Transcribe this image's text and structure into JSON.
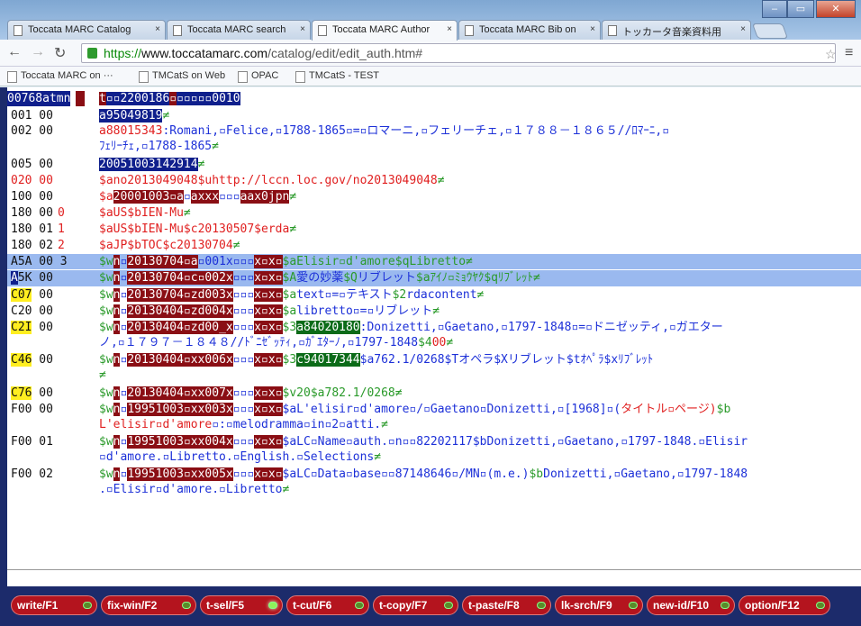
{
  "tabs": [
    {
      "label": "Toccata MARC Catalog"
    },
    {
      "label": "Toccata MARC search"
    },
    {
      "label": "Toccata MARC Author"
    },
    {
      "label": "Toccata MARC Bib on"
    },
    {
      "label": "トッカータ音楽資料用"
    }
  ],
  "address": {
    "https": "https://",
    "host": "www.toccatamarc.com",
    "path": "/catalog/edit/edit_auth.htm#"
  },
  "bookmarks": [
    "Toccata MARC on ···",
    "TMCatS on Web",
    "OPAC",
    "TMCatS - TEST"
  ],
  "leader": {
    "a": "00768atmn",
    "b": "t",
    "c": "▫▫2200186",
    "d": "▫",
    "e": "▫▫▫▫▫0010"
  },
  "rows": [
    {
      "tag": "001 00",
      "ind": "",
      "f": [
        {
          "t": "a95049819",
          "c": "sel"
        },
        {
          "t": "≠",
          "c": "grn"
        }
      ]
    },
    {
      "tag": "002 00",
      "ind": "",
      "f": [
        {
          "t": "a88015343",
          "c": "red"
        },
        {
          "t": ":Romani,▫Felice,▫1788-1865▫=▫ロマーニ,▫フェリーチェ,▫１７８８－１８６５//ﾛﾏｰﾆ,▫",
          "c": "blu"
        },
        {
          "br": true
        },
        {
          "t": "ﾌｪﾘｰﾁｪ,▫1788-1865",
          "c": "blu"
        },
        {
          "t": "≠",
          "c": "grn"
        }
      ]
    },
    {
      "tag": "005 00",
      "ind": "",
      "f": [
        {
          "t": "20051003142914",
          "c": "sel"
        },
        {
          "t": "≠",
          "c": "grn"
        }
      ]
    },
    {
      "tag": "020 00",
      "tagred": true,
      "ind": "",
      "f": [
        {
          "t": "$ano2013049048$uhttp://lccn.loc.gov/no2013049048",
          "c": "red"
        },
        {
          "t": "≠",
          "c": "grn"
        }
      ]
    },
    {
      "tag": "100 00",
      "ind": "",
      "f": [
        {
          "t": "$a",
          "c": "red"
        },
        {
          "t": "20001003",
          "c": "brn"
        },
        {
          "t": "▫a",
          "c": "brn"
        },
        {
          "t": "▫",
          "c": "blu"
        },
        {
          "t": "axxx",
          "c": "brn"
        },
        {
          "t": "▫▫▫",
          "c": "blu"
        },
        {
          "t": "aax0jpn",
          "c": "brn"
        },
        {
          "t": "≠",
          "c": "grn"
        }
      ]
    },
    {
      "tag": "180 00",
      "ind": "0",
      "f": [
        {
          "t": "$aUS$bIEN-Mu",
          "c": "red"
        },
        {
          "t": "≠",
          "c": "grn"
        }
      ]
    },
    {
      "tag": "180 01",
      "ind": "1",
      "f": [
        {
          "t": "$aUS$bIEN-Mu$c20130507$erda",
          "c": "red"
        },
        {
          "t": "≠",
          "c": "grn"
        }
      ]
    },
    {
      "tag": "180 02",
      "ind": "2",
      "f": [
        {
          "t": "$aJP$bTOC$c20130704",
          "c": "red"
        },
        {
          "t": "≠",
          "c": "grn"
        }
      ]
    },
    {
      "tag": "A5A 00 3",
      "hl": true,
      "ind": "",
      "f": [
        {
          "t": "$w",
          "c": "grn"
        },
        {
          "t": "n",
          "c": "brn"
        },
        {
          "t": "▫",
          "c": "blu"
        },
        {
          "t": "20130704",
          "c": "brn"
        },
        {
          "t": "▫a",
          "c": "brn"
        },
        {
          "t": "▫001x",
          "c": "blu"
        },
        {
          "t": "▫▫▫",
          "c": "blu"
        },
        {
          "t": "x▫x▫",
          "c": "brn"
        },
        {
          "t": "$aElisir▫d'amore$qLibretto",
          "c": "grn"
        },
        {
          "t": "≠",
          "c": "grn"
        }
      ]
    },
    {
      "tag": "A5K 00",
      "hl": true,
      "cursor": true,
      "ind": "",
      "f": [
        {
          "t": "$w",
          "c": "grn"
        },
        {
          "t": "n",
          "c": "brn"
        },
        {
          "t": "▫",
          "c": "blu"
        },
        {
          "t": "20130704",
          "c": "brn"
        },
        {
          "t": "▫c▫",
          "c": "brn"
        },
        {
          "t": "002x",
          "c": "brn"
        },
        {
          "t": "▫▫▫",
          "c": "blu"
        },
        {
          "t": "x▫x▫",
          "c": "brn"
        },
        {
          "t": "$A",
          "c": "grn"
        },
        {
          "t": "愛の妙薬",
          "c": "blu"
        },
        {
          "t": "$Q",
          "c": "grn"
        },
        {
          "t": "リブレット",
          "c": "blu"
        },
        {
          "t": "$aｱｲﾉ▫ﾐｮｳﾔｸ$qﾘﾌﾞﾚｯﾄ",
          "c": "grn"
        },
        {
          "t": "≠",
          "c": "grn"
        }
      ]
    },
    {
      "tag": "C07 00",
      "tagyel": true,
      "ind": "",
      "f": [
        {
          "t": "$w",
          "c": "grn"
        },
        {
          "t": "n",
          "c": "brn"
        },
        {
          "t": "▫",
          "c": "blu"
        },
        {
          "t": "20130704",
          "c": "brn"
        },
        {
          "t": "▫zd003x",
          "c": "brn"
        },
        {
          "t": "▫▫▫",
          "c": "blu"
        },
        {
          "t": "x▫x▫",
          "c": "brn"
        },
        {
          "t": "$a",
          "c": "grn"
        },
        {
          "t": "text▫=▫テキスト",
          "c": "blu"
        },
        {
          "t": "$2",
          "c": "grn"
        },
        {
          "t": "rdacontent",
          "c": "blu"
        },
        {
          "t": "≠",
          "c": "grn"
        }
      ]
    },
    {
      "tag": "C20 00",
      "ind": "",
      "f": [
        {
          "t": "$w",
          "c": "grn"
        },
        {
          "t": "n",
          "c": "brn"
        },
        {
          "t": "▫",
          "c": "blu"
        },
        {
          "t": "20130404",
          "c": "brn"
        },
        {
          "t": "▫zd004x",
          "c": "brn"
        },
        {
          "t": "▫▫▫",
          "c": "blu"
        },
        {
          "t": "x▫x▫",
          "c": "brn"
        },
        {
          "t": "$a",
          "c": "grn"
        },
        {
          "t": "libretto▫=▫リブレット",
          "c": "blu"
        },
        {
          "t": "≠",
          "c": "grn"
        }
      ]
    },
    {
      "tag": "C2I 00",
      "tagyel": true,
      "ind": "",
      "f": [
        {
          "t": "$w",
          "c": "grn"
        },
        {
          "t": "n",
          "c": "brn"
        },
        {
          "t": "▫",
          "c": "blu"
        },
        {
          "t": "20130404",
          "c": "brn"
        },
        {
          "t": "▫zd00_x",
          "c": "brn"
        },
        {
          "t": "▫▫▫",
          "c": "blu"
        },
        {
          "t": "x▫x▫",
          "c": "brn"
        },
        {
          "t": "$3",
          "c": "grn"
        },
        {
          "t": "a84020180",
          "c": "grnbg"
        },
        {
          "t": ":Donizetti,▫Gaetano,▫1797-1848▫=▫ドニゼッティ,▫ガエター",
          "c": "blu"
        },
        {
          "br": true
        },
        {
          "t": "ノ,▫１７９７－１８４８//ﾄﾞﾆｾﾞｯﾃｨ,▫ｶﾞｴﾀｰﾉ,▫1797-1848",
          "c": "blu"
        },
        {
          "t": "$4",
          "c": "grn"
        },
        {
          "t": "00",
          "c": "red"
        },
        {
          "t": "≠",
          "c": "grn"
        }
      ]
    },
    {
      "tag": "C46 00",
      "tagyel": true,
      "ind": "",
      "f": [
        {
          "t": "$w",
          "c": "grn"
        },
        {
          "t": "n",
          "c": "brn"
        },
        {
          "t": "▫",
          "c": "blu"
        },
        {
          "t": "20130404",
          "c": "brn"
        },
        {
          "t": "▫xx006x",
          "c": "brn"
        },
        {
          "t": "▫▫▫",
          "c": "blu"
        },
        {
          "t": "x▫x▫",
          "c": "brn"
        },
        {
          "t": "$3",
          "c": "grn"
        },
        {
          "t": "c94017344",
          "c": "grnbg"
        },
        {
          "t": "$a762.1/0268$T",
          "c": "blu"
        },
        {
          "t": "オペラ",
          "c": "blu"
        },
        {
          "t": "$X",
          "c": "blu"
        },
        {
          "t": "リブレット",
          "c": "blu"
        },
        {
          "t": "$tｵﾍﾟﾗ$xﾘﾌﾞﾚｯﾄ",
          "c": "blu"
        },
        {
          "br": true
        },
        {
          "t": "≠",
          "c": "grn"
        }
      ]
    },
    {
      "tag": "C76 00",
      "tagyel": true,
      "ind": "",
      "f": [
        {
          "t": "$w",
          "c": "grn"
        },
        {
          "t": "n",
          "c": "brn"
        },
        {
          "t": "▫",
          "c": "blu"
        },
        {
          "t": "20130404",
          "c": "brn"
        },
        {
          "t": "▫xx007x",
          "c": "brn"
        },
        {
          "t": "▫▫▫",
          "c": "blu"
        },
        {
          "t": "x▫x▫",
          "c": "brn"
        },
        {
          "t": "$v20$a782.1/0268",
          "c": "grn"
        },
        {
          "t": "≠",
          "c": "grn"
        }
      ]
    },
    {
      "tag": "F00 00",
      "ind": "",
      "f": [
        {
          "t": "$w",
          "c": "grn"
        },
        {
          "t": "n",
          "c": "brn"
        },
        {
          "t": "▫",
          "c": "blu"
        },
        {
          "t": "19951003",
          "c": "brn"
        },
        {
          "t": "▫xx003x",
          "c": "brn"
        },
        {
          "t": "▫▫▫",
          "c": "blu"
        },
        {
          "t": "x▫x▫",
          "c": "brn"
        },
        {
          "t": "$aL'elisir▫d'amore▫/▫Gaetano▫Donizetti,▫[1968]▫(",
          "c": "blu"
        },
        {
          "t": "タイトル▫ページ)",
          "c": "red"
        },
        {
          "t": "$b",
          "c": "grn"
        },
        {
          "br": true
        },
        {
          "t": "L'elisir▫d'amore",
          "c": "red"
        },
        {
          "t": "▫:▫melodramma▫in▫2▫atti.",
          "c": "blu"
        },
        {
          "t": "≠",
          "c": "grn"
        }
      ]
    },
    {
      "tag": "F00 01",
      "ind": "",
      "f": [
        {
          "t": "$w",
          "c": "grn"
        },
        {
          "t": "n",
          "c": "brn"
        },
        {
          "t": "▫",
          "c": "blu"
        },
        {
          "t": "19951003",
          "c": "brn"
        },
        {
          "t": "▫xx004x",
          "c": "brn"
        },
        {
          "t": "▫▫▫",
          "c": "blu"
        },
        {
          "t": "x▫x▫",
          "c": "brn"
        },
        {
          "t": "$aLC▫Name▫auth.▫n▫▫82202117$bDonizetti,▫Gaetano,▫1797-1848.▫Elisir",
          "c": "blu"
        },
        {
          "br": true
        },
        {
          "t": "▫d'amore.▫Libretto.▫English.▫Selections",
          "c": "blu"
        },
        {
          "t": "≠",
          "c": "grn"
        }
      ]
    },
    {
      "tag": "F00 02",
      "ind": "",
      "f": [
        {
          "t": "$w",
          "c": "grn"
        },
        {
          "t": "n",
          "c": "brn"
        },
        {
          "t": "▫",
          "c": "blu"
        },
        {
          "t": "19951003",
          "c": "brn"
        },
        {
          "t": "▫xx005x",
          "c": "brn"
        },
        {
          "t": "▫▫▫",
          "c": "blu"
        },
        {
          "t": "x▫x▫",
          "c": "brn"
        },
        {
          "t": "$aLC▫Data▫base▫▫87148646▫/MN▫(m.e.)",
          "c": "blu"
        },
        {
          "t": "$b",
          "c": "grn"
        },
        {
          "t": "Donizetti,▫Gaetano,▫1797-1848",
          "c": "blu"
        },
        {
          "br": true
        },
        {
          "t": ".▫Elisir▫d'amore.▫Libretto",
          "c": "blu"
        },
        {
          "t": "≠",
          "c": "grn"
        }
      ]
    }
  ],
  "fkeys": [
    {
      "label": "write/F1"
    },
    {
      "label": "fix-win/F2"
    },
    {
      "label": "t-sel/F5",
      "on": true
    },
    {
      "label": "t-cut/F6"
    },
    {
      "label": "t-copy/F7"
    },
    {
      "label": "t-paste/F8"
    },
    {
      "label": "lk-srch/F9"
    },
    {
      "label": "new-id/F10"
    },
    {
      "label": "option/F12"
    }
  ]
}
